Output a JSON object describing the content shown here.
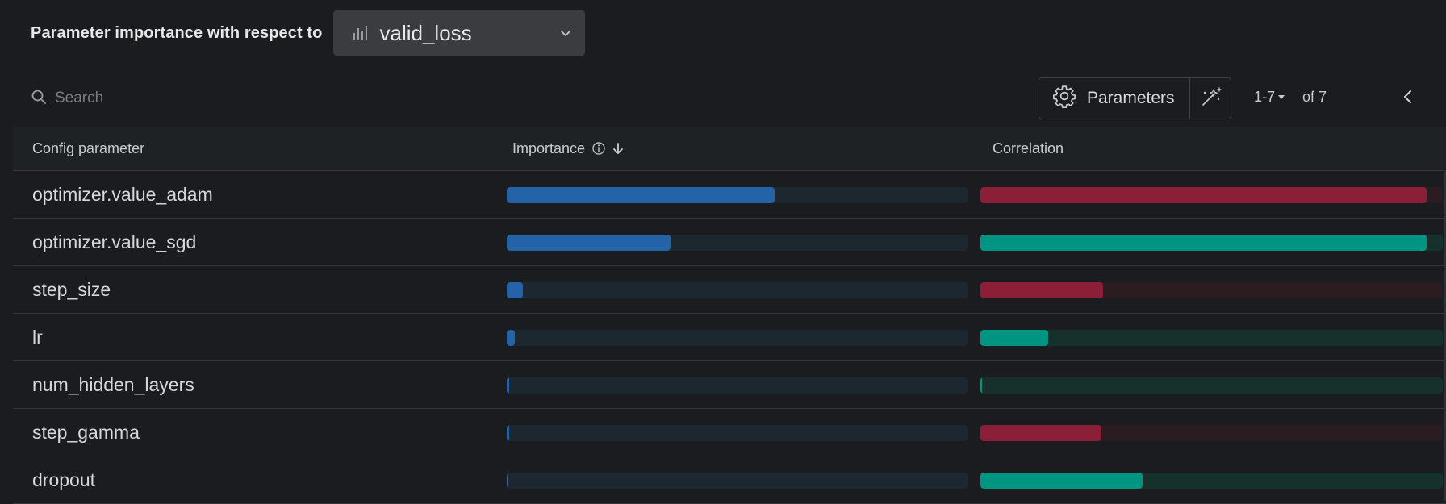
{
  "header": {
    "label": "Parameter importance with respect to",
    "metric": "valid_loss",
    "metric_icon": "bar-chart-icon"
  },
  "toolbar": {
    "search_placeholder": "Search",
    "parameters_label": "Parameters",
    "pager_range": "1-7",
    "pager_of": "of 7"
  },
  "table": {
    "columns": {
      "param": "Config parameter",
      "importance": "Importance",
      "correlation": "Correlation"
    },
    "rows": [
      {
        "name": "optimizer.value_adam",
        "importance": 0.58,
        "correlation": -0.965
      },
      {
        "name": "optimizer.value_sgd",
        "importance": 0.355,
        "correlation": 0.965
      },
      {
        "name": "step_size",
        "importance": 0.035,
        "correlation": -0.265
      },
      {
        "name": "lr",
        "importance": 0.018,
        "correlation": 0.147
      },
      {
        "name": "num_hidden_layers",
        "importance": 0.006,
        "correlation": 0.003
      },
      {
        "name": "step_gamma",
        "importance": 0.005,
        "correlation": -0.262
      },
      {
        "name": "dropout",
        "importance": 0.004,
        "correlation": 0.35
      }
    ]
  },
  "colors": {
    "importance": "#2563a8",
    "positive": "#009583",
    "negative": "#8c1f38"
  }
}
